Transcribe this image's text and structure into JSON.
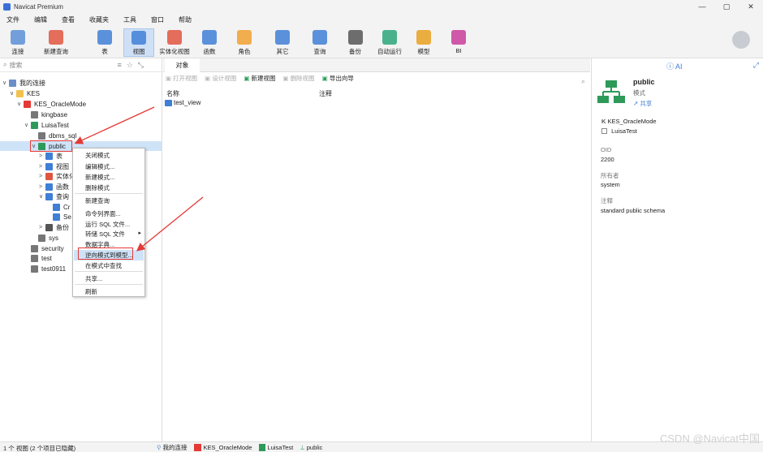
{
  "window": {
    "title": "Navicat Premium",
    "controls": [
      "—",
      "▢",
      "✕"
    ]
  },
  "menu": [
    "文件",
    "编辑",
    "查看",
    "收藏夹",
    "工具",
    "窗口",
    "帮助"
  ],
  "toolbar": {
    "buttons": [
      {
        "label": "连接",
        "icon": "connect-icon",
        "color": "#5b8fd6"
      },
      {
        "label": "新建查询",
        "icon": "new-query-icon",
        "color": "#e05540"
      },
      {
        "label": "表",
        "icon": "table-icon",
        "color": "#3f7fd6"
      },
      {
        "label": "视图",
        "icon": "view-icon",
        "color": "#3f7fd6"
      },
      {
        "label": "实体化视图",
        "icon": "materialized-view-icon",
        "color": "#e05540"
      },
      {
        "label": "函数",
        "icon": "function-icon",
        "color": "#3f7fd6"
      },
      {
        "label": "角色",
        "icon": "role-icon",
        "color": "#f0a030"
      },
      {
        "label": "其它",
        "icon": "other-icon",
        "color": "#3f7fd6"
      },
      {
        "label": "查询",
        "icon": "query-icon",
        "color": "#3f7fd6"
      },
      {
        "label": "备份",
        "icon": "backup-icon",
        "color": "#555"
      },
      {
        "label": "自动运行",
        "icon": "robot-icon",
        "color": "#2aa67a"
      },
      {
        "label": "模型",
        "icon": "model-icon",
        "color": "#e8a020"
      },
      {
        "label": "BI",
        "icon": "bi-icon",
        "color": "#c83c9a"
      }
    ]
  },
  "left": {
    "search_placeholder": "搜索",
    "tree": [
      {
        "label": "我的连接",
        "level": 0,
        "arrow": "∨",
        "icon": "connection-icon",
        "color": "#6a8fc8"
      },
      {
        "label": "KES",
        "level": 1,
        "arrow": "∨",
        "icon": "folder-icon",
        "color": "#f2c14e"
      },
      {
        "label": "KES_OracleMode",
        "level": 2,
        "arrow": "∨",
        "icon": "kes-icon",
        "color": "#e53935"
      },
      {
        "label": "kingbase",
        "level": 3,
        "arrow": "",
        "icon": "database-icon",
        "color": "#777"
      },
      {
        "label": "LuisaTest",
        "level": 3,
        "arrow": "∨",
        "icon": "database-icon",
        "color": "#2e9a5a"
      },
      {
        "label": "dbms_sql",
        "level": 4,
        "arrow": "",
        "icon": "schema-icon",
        "color": "#777"
      },
      {
        "label": "public",
        "level": 4,
        "arrow": "∨",
        "icon": "schema-icon",
        "color": "#2e9a5a"
      },
      {
        "label": "表",
        "level": 5,
        "arrow": ">",
        "icon": "table-icon",
        "color": "#3f7fd6"
      },
      {
        "label": "视图",
        "level": 5,
        "arrow": ">",
        "icon": "view-icon",
        "color": "#3f7fd6"
      },
      {
        "label": "实体化",
        "level": 5,
        "arrow": ">",
        "icon": "materialized-view-icon",
        "color": "#e05540"
      },
      {
        "label": "函数",
        "level": 5,
        "arrow": ">",
        "icon": "function-icon",
        "color": "#3f7fd6"
      },
      {
        "label": "查询",
        "level": 5,
        "arrow": "∨",
        "icon": "query-icon",
        "color": "#3f7fd6"
      },
      {
        "label": "Cr",
        "level": 6,
        "arrow": "",
        "icon": "query-icon",
        "color": "#3f7fd6"
      },
      {
        "label": "Se",
        "level": 6,
        "arrow": "",
        "icon": "query-icon",
        "color": "#3f7fd6"
      },
      {
        "label": "备份",
        "level": 5,
        "arrow": ">",
        "icon": "backup-icon",
        "color": "#555"
      },
      {
        "label": "sys",
        "level": 4,
        "arrow": "",
        "icon": "schema-icon",
        "color": "#777"
      },
      {
        "label": "security",
        "level": 3,
        "arrow": "",
        "icon": "database-icon",
        "color": "#777"
      },
      {
        "label": "test",
        "level": 3,
        "arrow": "",
        "icon": "database-icon",
        "color": "#777"
      },
      {
        "label": "test0911",
        "level": 3,
        "arrow": "",
        "icon": "database-icon",
        "color": "#777"
      }
    ]
  },
  "context_menu": {
    "items": [
      "关闭模式",
      "编辑模式...",
      "新建模式...",
      "删除模式",
      "新建查询",
      "命令列界面...",
      "运行 SQL 文件...",
      "转储 SQL 文件",
      "数据字典...",
      "逆向模式到模型...",
      "在模式中查找",
      "共享...",
      "刷新"
    ],
    "submenu_arrow": "▸"
  },
  "center": {
    "tab": "对象",
    "toolbar": [
      {
        "label": "打开视图",
        "enabled": false
      },
      {
        "label": "设计视图",
        "enabled": false
      },
      {
        "label": "新建视图",
        "enabled": true
      },
      {
        "label": "删除视图",
        "enabled": false
      },
      {
        "label": "导出向导",
        "enabled": true
      }
    ],
    "columns": [
      "名称",
      "注释"
    ],
    "rows": [
      "test_view"
    ]
  },
  "right": {
    "name": "public",
    "type": "模式",
    "share": "共享",
    "connection": "KES_OracleMode",
    "database": "LuisaTest",
    "oid_label": "OID",
    "oid": "2200",
    "owner_label": "所有者",
    "owner": "system",
    "comment_label": "注释",
    "comment": "standard public schema",
    "top_icons": "ⓘ AI"
  },
  "status": {
    "left": "1 个 视图 (2 个项目已隐藏)",
    "crumbs": [
      "我的连接",
      "KES_OracleMode",
      "LuisaTest",
      "public"
    ]
  },
  "watermark": "CSDN @Navicat中国"
}
